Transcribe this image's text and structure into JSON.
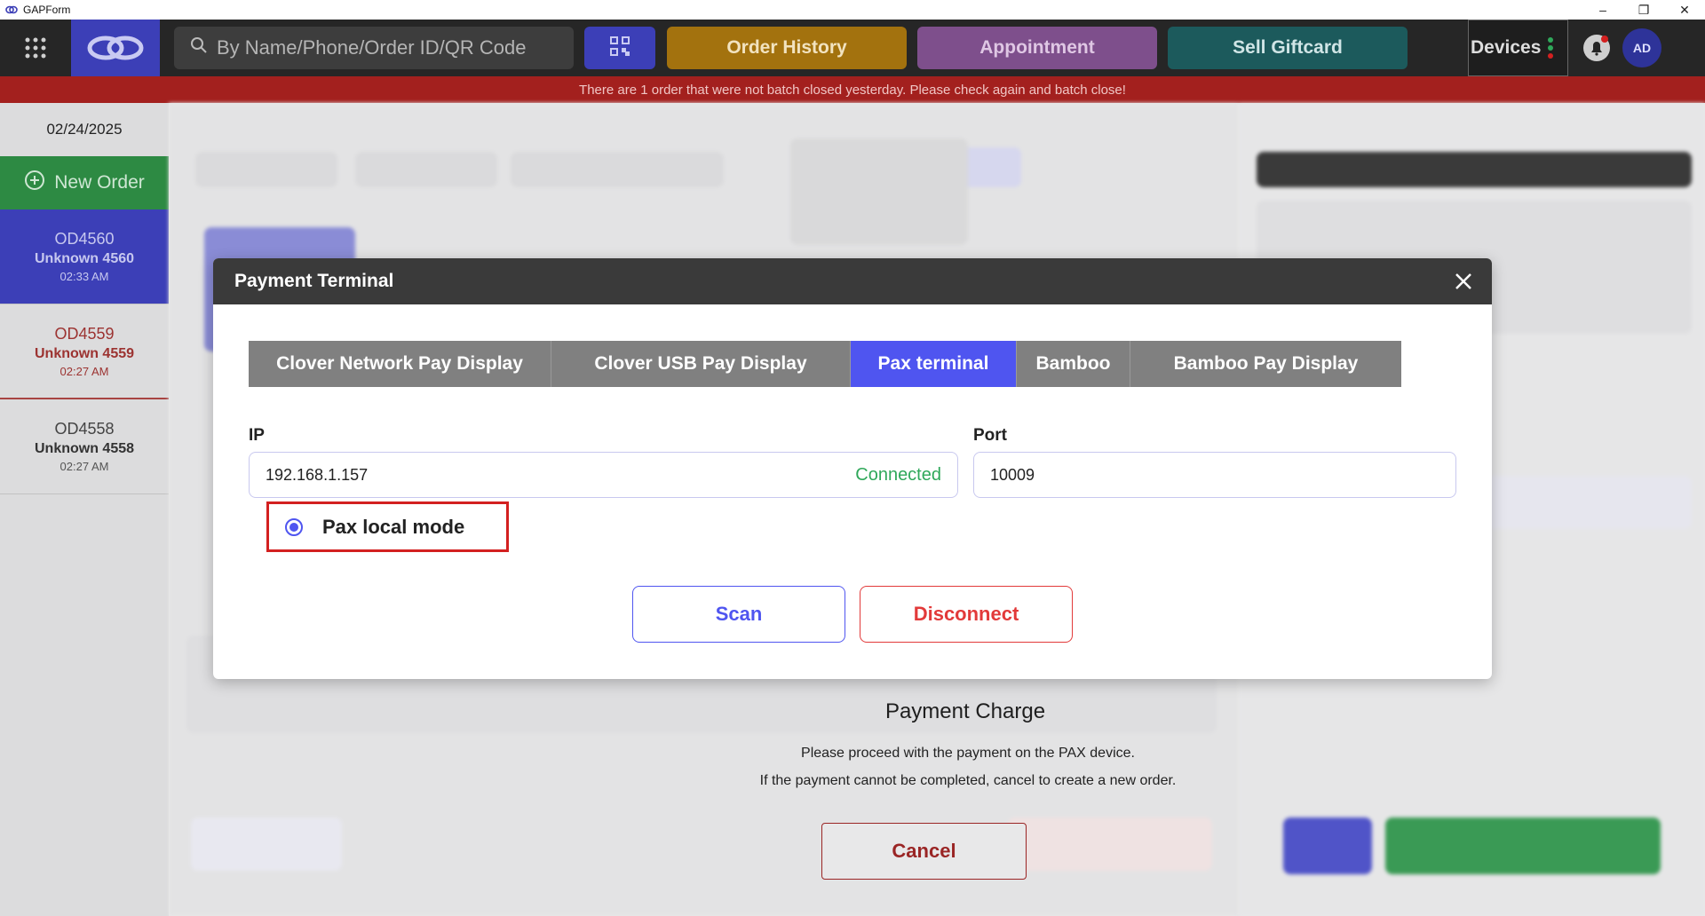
{
  "window": {
    "title": "GAPForm",
    "minimize": "–",
    "restore": "❐",
    "close": "✕"
  },
  "topnav": {
    "search_placeholder": "By Name/Phone/Order ID/QR Code",
    "order_history": "Order History",
    "appointment": "Appointment",
    "sell_giftcard": "Sell Giftcard",
    "devices": "Devices",
    "avatar": "AD",
    "colors": {
      "brand": "#3c3fb7",
      "history": "#a3720e",
      "appointment": "#7e4f8c",
      "giftcard": "#1c5a5c"
    }
  },
  "alert": {
    "text": "There are 1 order that were not batch closed yesterday. Please check again and batch close!"
  },
  "sidebar": {
    "date": "02/24/2025",
    "new_order": "New Order",
    "orders": [
      {
        "id": "OD4560",
        "name": "Unknown 4560",
        "time": "02:33 AM",
        "state": "active"
      },
      {
        "id": "OD4559",
        "name": "Unknown 4559",
        "time": "02:27 AM",
        "state": "red"
      },
      {
        "id": "OD4558",
        "name": "Unknown 4558",
        "time": "02:27 AM",
        "state": "normal"
      }
    ]
  },
  "payment": {
    "title": "Payment Charge",
    "line1": "Please proceed with the payment on the PAX device.",
    "line2": "If the payment cannot be completed, cancel to create a new order.",
    "cancel": "Cancel"
  },
  "modal": {
    "title": "Payment Terminal",
    "tabs": [
      {
        "label": "Clover Network Pay Display",
        "active": false
      },
      {
        "label": "Clover USB Pay Display",
        "active": false
      },
      {
        "label": "Pax terminal",
        "active": true
      },
      {
        "label": "Bamboo",
        "active": false
      },
      {
        "label": "Bamboo Pay Display",
        "active": false
      }
    ],
    "ip_label": "IP",
    "ip_value": "192.168.1.157",
    "ip_status": "Connected",
    "port_label": "Port",
    "port_value": "10009",
    "local_mode_label": "Pax local mode",
    "local_mode_selected": true,
    "scan": "Scan",
    "disconnect": "Disconnect",
    "colors": {
      "accent": "#4f55f0",
      "danger": "#e23a3a",
      "success": "#2fa85a",
      "highlight": "#d32020"
    }
  }
}
